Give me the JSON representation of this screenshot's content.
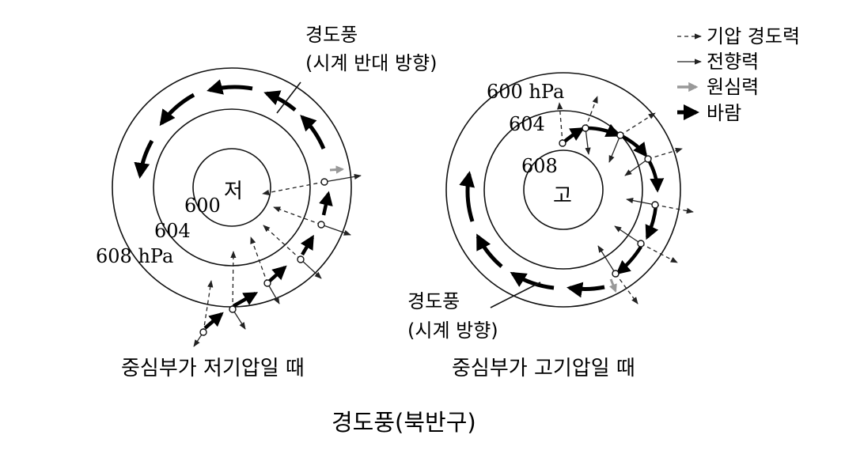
{
  "low": {
    "center_label": "저",
    "isobars": [
      "600",
      "604",
      "608 hPa"
    ],
    "wind_title": "경도풍",
    "wind_direction": "(시계 반대 방향)",
    "caption": "중심부가 저기압일 때"
  },
  "high": {
    "center_label": "고",
    "isobars": [
      "600 hPa",
      "604",
      "608"
    ],
    "wind_title": "경도풍",
    "wind_direction": "(시계 방향)",
    "caption": "중심부가 고기압일 때"
  },
  "legend": [
    {
      "label": "기압 경도력",
      "style": "dashed-arrow",
      "color": "#222222"
    },
    {
      "label": "전향력",
      "style": "thin-arrow",
      "color": "#222222"
    },
    {
      "label": "원심력",
      "style": "gray-arrow",
      "color": "#999999"
    },
    {
      "label": "바람",
      "style": "bold-arrow",
      "color": "#000000"
    }
  ],
  "main_title": "경도풍(북반구)"
}
